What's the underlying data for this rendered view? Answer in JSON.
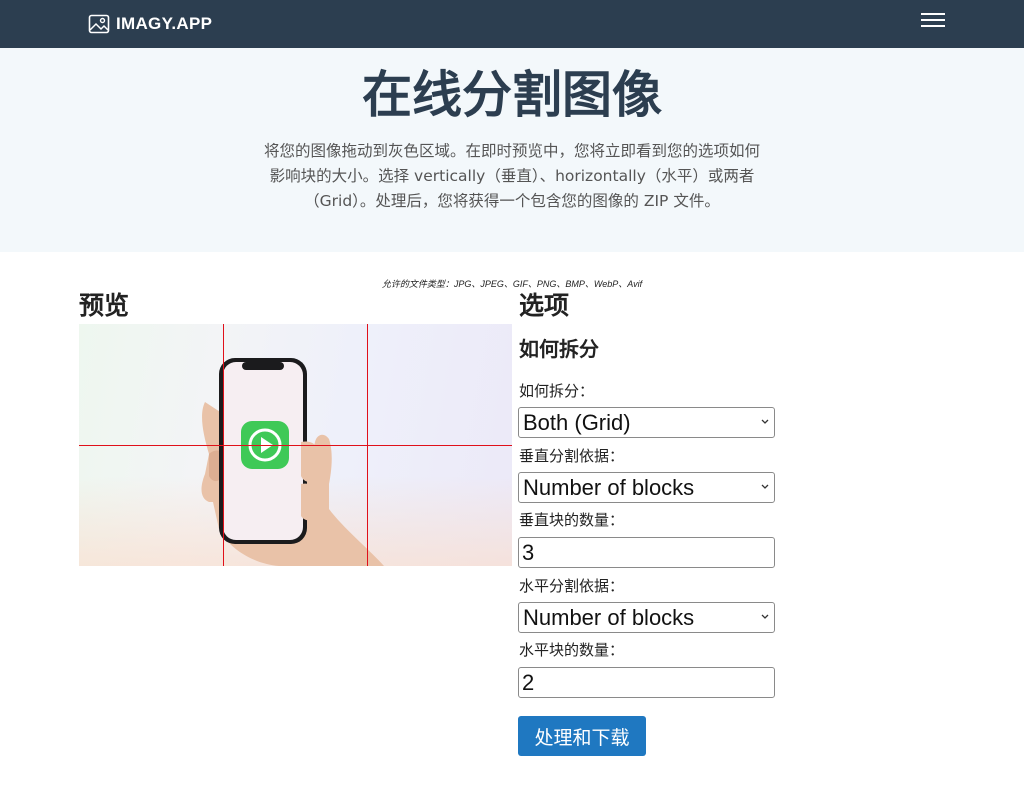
{
  "navbar": {
    "brand": "IMAGY.APP",
    "brand_icon": "image-icon",
    "menu_icon": "hamburger-menu-icon",
    "background": "#2c3e50"
  },
  "hero": {
    "title": "在线分割图像",
    "description": "将您的图像拖动到灰色区域。在即时预览中，您将立即看到您的选项如何影响块的大小。选择 vertically（垂直）、horizontally（水平）或两者（Grid）。处理后，您将获得一个包含您的图像的 ZIP 文件。"
  },
  "upload": {
    "allowed_types": "允许的文件类型：JPG、JPEG、GIF、PNG、BMP、WebP、Avif"
  },
  "preview": {
    "title": "预览",
    "grid_line_color": "#e0101a"
  },
  "options": {
    "title": "选项",
    "subtitle": "如何拆分",
    "split_mode": {
      "label": "如何拆分：",
      "value": "Both (Grid)"
    },
    "vertical_split_by": {
      "label": "垂直分割依据：",
      "value": "Number of blocks"
    },
    "vertical_count": {
      "label": "垂直块的数量：",
      "value": "3"
    },
    "horizontal_split_by": {
      "label": "水平分割依据：",
      "value": "Number of blocks"
    },
    "horizontal_count": {
      "label": "水平块的数量：",
      "value": "2"
    },
    "submit": {
      "label": "处理和下载",
      "color": "#1f78c1"
    }
  }
}
